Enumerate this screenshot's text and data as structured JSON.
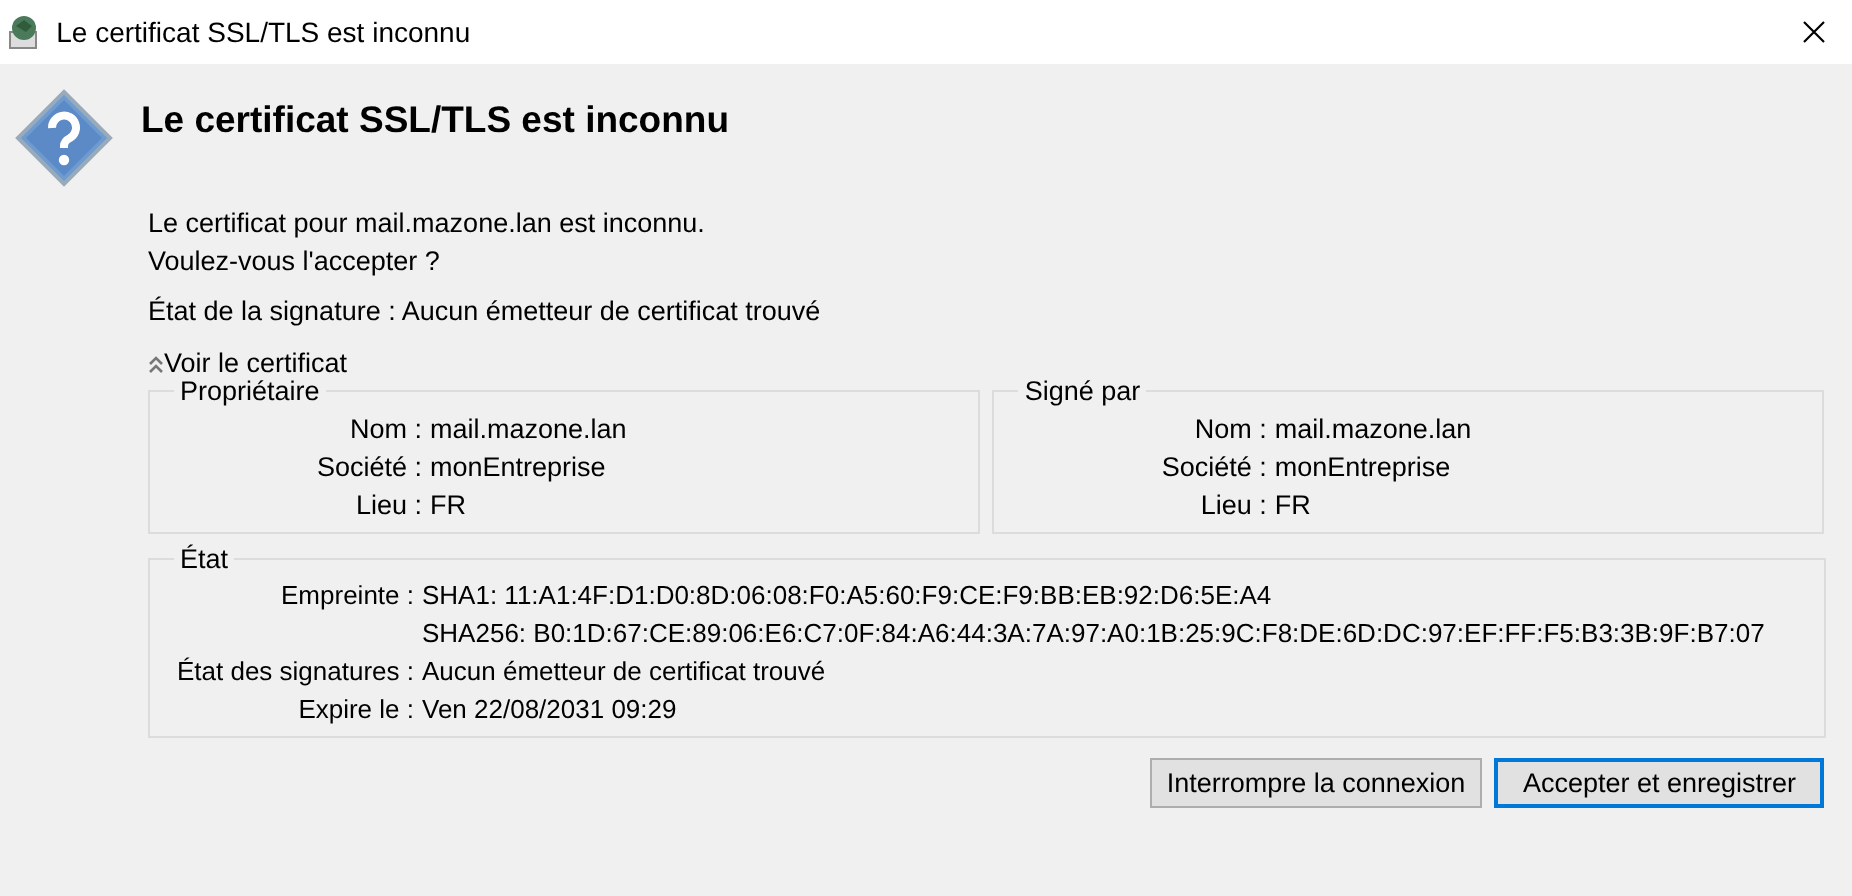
{
  "window": {
    "title": "Le certificat SSL/TLS est inconnu"
  },
  "heading": "Le certificat SSL/TLS est inconnu",
  "message": [
    "Le certificat pour mail.mazone.lan est inconnu.",
    "Voulez-vous l'accepter ?"
  ],
  "signature_status": "État de la signature : Aucun émetteur de certificat trouvé",
  "details_toggle": {
    "label": "Voir le certificat",
    "expanded": true
  },
  "owner": {
    "title": "Propriétaire",
    "fields": [
      {
        "label": "Nom :",
        "values": [
          "mail.mazone.lan"
        ]
      },
      {
        "label": "Société :",
        "values": [
          "monEntreprise"
        ]
      },
      {
        "label": "Lieu :",
        "values": [
          "FR"
        ]
      }
    ]
  },
  "signed_by": {
    "title": "Signé par",
    "fields": [
      {
        "label": "Nom :",
        "values": [
          "mail.mazone.lan"
        ]
      },
      {
        "label": "Société :",
        "values": [
          "monEntreprise"
        ]
      },
      {
        "label": "Lieu :",
        "values": [
          "FR"
        ]
      }
    ]
  },
  "state": {
    "title": "État",
    "fields": [
      {
        "label": "Empreinte :",
        "values": [
          "SHA1: 11:A1:4F:D1:D0:8D:06:08:F0:A5:60:F9:CE:F9:BB:EB:92:D6:5E:A4",
          "SHA256: B0:1D:67:CE:89:06:E6:C7:0F:84:A6:44:3A:7A:97:A0:1B:25:9C:F8:DE:6D:DC:97:EF:FF:F5:B3:3B:9F:B7:07"
        ]
      },
      {
        "label": "État des signatures :",
        "values": [
          "Aucun émetteur de certificat trouvé"
        ]
      },
      {
        "label": "Expire le :",
        "values": [
          "Ven 22/08/2031 09:29"
        ]
      }
    ]
  },
  "buttons": [
    {
      "label": "Interrompre la connexion",
      "default": false
    },
    {
      "label": "Accepter et enregistrer",
      "default": true
    }
  ]
}
